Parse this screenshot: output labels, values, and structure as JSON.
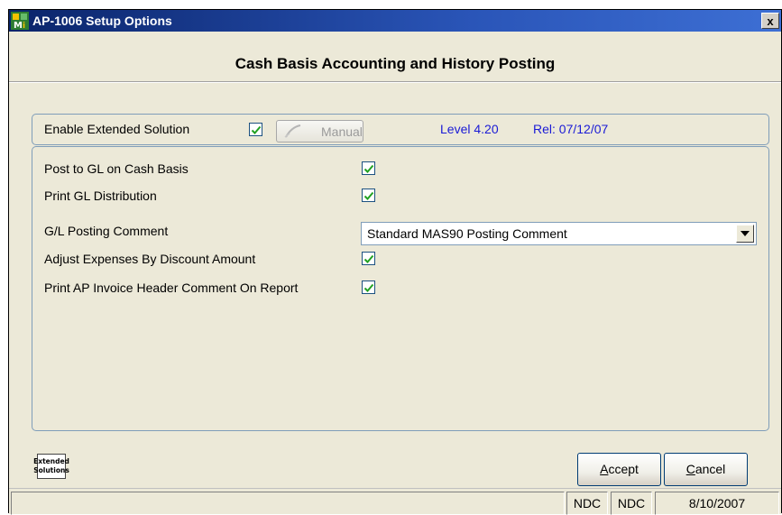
{
  "window": {
    "title": "AP-1006 Setup Options",
    "close_label": "x"
  },
  "heading": "Cash Basis Accounting and History Posting",
  "enable": {
    "label": "Enable Extended Solution",
    "checked": true,
    "manual_label": "Manual",
    "level": "Level 4.20",
    "release": "Rel: 07/12/07"
  },
  "options": [
    {
      "label": "Post to GL on Cash Basis",
      "checked": true
    },
    {
      "label": "Print GL Distribution",
      "checked": true
    },
    {
      "label": "G/L Posting Comment",
      "value": "Standard MAS90 Posting Comment"
    },
    {
      "label": "Adjust Expenses By Discount Amount",
      "checked": true
    },
    {
      "label": "Print AP Invoice Header Comment On Report",
      "checked": true
    }
  ],
  "logo": {
    "line1": "Extended",
    "line2": "Solutions"
  },
  "buttons": {
    "accept_first": "A",
    "accept_rest": "ccept",
    "cancel_first": "C",
    "cancel_rest": "ancel"
  },
  "status": {
    "field1": "",
    "company": "NDC",
    "user": "NDC",
    "date": "8/10/2007"
  },
  "colors": {
    "level_text": "#1a1ad6",
    "check_mark": "#21a121",
    "title_bar": "#0a246a"
  }
}
